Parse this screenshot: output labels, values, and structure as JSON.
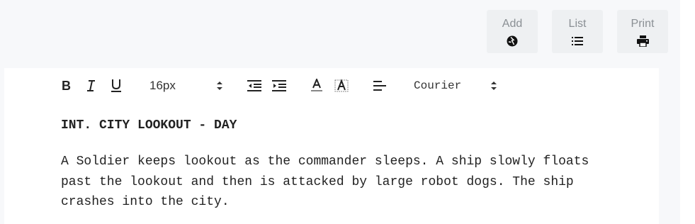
{
  "actions": {
    "add_label": "Add",
    "list_label": "List",
    "print_label": "Print",
    "add_icon": "add-icon",
    "list_icon": "list-icon",
    "print_icon": "print-icon"
  },
  "toolbar": {
    "font_size": "16px",
    "font_family": "Courier",
    "icons": [
      "bold-icon",
      "italic-icon",
      "underline-icon",
      "outdent-icon",
      "indent-icon",
      "text-color-icon",
      "highlight-color-icon",
      "align-left-icon"
    ]
  },
  "script": {
    "scene_heading": "INT. CITY LOOKOUT - DAY",
    "action": "A Soldier keeps lookout as the commander sleeps. A ship slowly floats past the lookout and then is attacked by large robot dogs. The ship crashes into the city."
  },
  "colors": {
    "app_background": "#f7f8fa",
    "button_background": "#eef0f2",
    "editor_background": "#ffffff",
    "text": "#222222"
  }
}
